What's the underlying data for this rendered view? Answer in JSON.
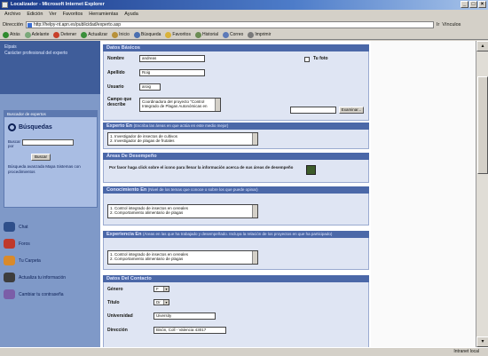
{
  "window": {
    "title": "Localizador - Microsoft Internet Explorer"
  },
  "menu": [
    "Archivo",
    "Edición",
    "Ver",
    "Favoritos",
    "Herramientas",
    "Ayuda"
  ],
  "address": {
    "label": "Dirección",
    "url": "http://helpy-nt.apn.es/publicidad/experto.asp",
    "go": "Ir",
    "links": "Vínculos"
  },
  "toolbar": [
    "Atrás",
    "Adelante",
    "Detener",
    "Actualizar",
    "Inicio",
    "Búsqueda",
    "Favoritos",
    "Historial",
    "Correo",
    "Imprimir"
  ],
  "status": {
    "zone": "Intranet local"
  },
  "sidenav": {
    "top_line1": "Elpais",
    "top_line2": "Carácter profesional del experto",
    "search_header": "Buscador de expertos",
    "search_title": "Búsquedas",
    "search_label": "Buscar por",
    "search_button": "Buscar",
    "advanced": "Búsqueda avanzada Mapa Sistemas con procedimientos",
    "links": [
      "Chat",
      "Foros",
      "Tu Carpeta",
      "Actualiza tu información",
      "Cambiar tu contraseña"
    ]
  },
  "form": {
    "basic": {
      "header": "Datos Básicos",
      "name_label": "Nombre",
      "name_value": "andreas",
      "surname_label": "Apellido",
      "surname_value": "Roig",
      "user_label": "Usuario",
      "user_value": "aroig",
      "desc_label": "Campo que describe",
      "desc_value": "Coordinadora del proyecto \"Control Integrado de Plagas Autonómicas en",
      "photo_label": "Tu foto",
      "browse_button": "Examinar..."
    },
    "expert": {
      "header": "Experto En",
      "header_note": "(Escriba las áreas en que actúa en este medio mejor)",
      "lines": [
        "1. Investigador de insectos de cultivos",
        "2. Investigador de plagas de frutales"
      ]
    },
    "areas": {
      "header": "Áreas De Desempeño",
      "text": "Por favor haga click sobre el icono para llenar la información acerca de sus áreas de desempeño"
    },
    "knowledge": {
      "header": "Conocimiento En",
      "header_note": "(Nivel de los temas que conoce o sobre los que puede opinar)",
      "lines": [
        "1. Control integrado de insectos en cereales",
        "2. Comportamiento alimentario de plagas"
      ]
    },
    "experience": {
      "header": "Experiencia En",
      "header_note": "(Áreas en las que ha trabajado y desempeñado. Incluya la relación de los proyectos en que ha participado)",
      "lines": [
        "1. Control integrado de insectos en cereales",
        "2. Comportamiento alimentario de plagas"
      ]
    },
    "contact": {
      "header": "Datos Del Contacto",
      "gender_label": "Género",
      "gender_value": "F",
      "title_label": "Título",
      "title_value": "Dr",
      "university_label": "Universidad",
      "university_value": "Uiversity",
      "address_label": "Dirección",
      "address_value": "Bisón, Coll - Valencia 43017"
    }
  }
}
